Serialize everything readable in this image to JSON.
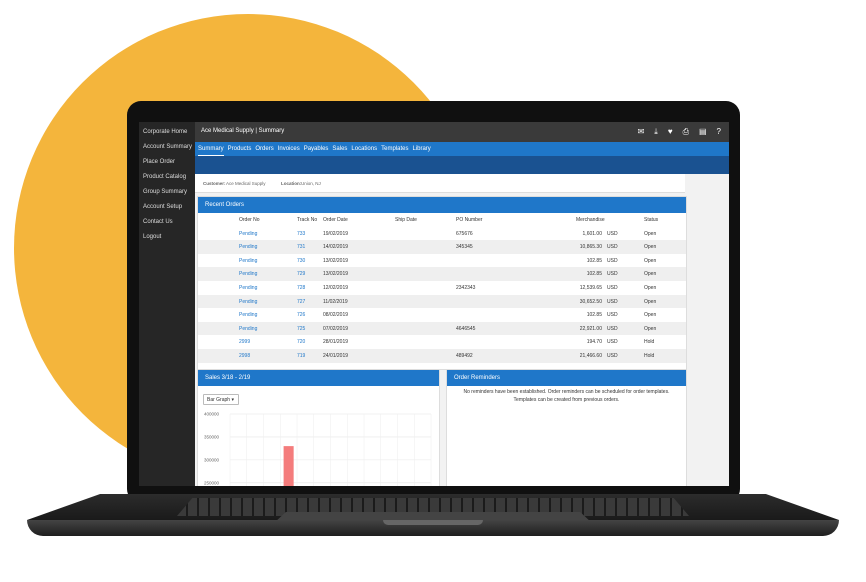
{
  "sidebar": {
    "items": [
      "Corporate Home",
      "Account Summary",
      "Place Order",
      "Product Catalog",
      "Group Summary",
      "Account Setup",
      "Contact Us",
      "Logout"
    ]
  },
  "header": {
    "title": "Ace Medical Supply  |  Summary",
    "icons": [
      "mail-icon",
      "download-icon",
      "heart-icon",
      "print-icon",
      "card-icon",
      "help-icon"
    ]
  },
  "nav": {
    "tabs": [
      "Summary",
      "Products",
      "Orders",
      "Invoices",
      "Payables",
      "Sales",
      "Locations",
      "Templates",
      "Library"
    ],
    "active": "Summary"
  },
  "customer": {
    "customer_label": "Customer:",
    "customer_value": "Ace Medical Supply",
    "location_label": "Location:",
    "location_value": "Union, NJ"
  },
  "recent_orders": {
    "title": "Recent Orders",
    "columns": [
      "Order No",
      "Track No",
      "Order Date",
      "Ship Date",
      "PO Number",
      "Merchandise",
      "Status"
    ],
    "rows": [
      {
        "order": "Pending",
        "track": "733",
        "date": "19/02/2019",
        "ship": "",
        "po": "675676",
        "amount": "1,601.00",
        "cur": "USD",
        "status": "Open"
      },
      {
        "order": "Pending",
        "track": "731",
        "date": "14/02/2019",
        "ship": "",
        "po": "345345",
        "amount": "10,865.30",
        "cur": "USD",
        "status": "Open"
      },
      {
        "order": "Pending",
        "track": "730",
        "date": "13/02/2019",
        "ship": "",
        "po": "",
        "amount": "102.85",
        "cur": "USD",
        "status": "Open"
      },
      {
        "order": "Pending",
        "track": "729",
        "date": "13/02/2019",
        "ship": "",
        "po": "",
        "amount": "102.85",
        "cur": "USD",
        "status": "Open"
      },
      {
        "order": "Pending",
        "track": "728",
        "date": "12/02/2019",
        "ship": "",
        "po": "2342343",
        "amount": "12,539.65",
        "cur": "USD",
        "status": "Open"
      },
      {
        "order": "Pending",
        "track": "727",
        "date": "11/02/2019",
        "ship": "",
        "po": "",
        "amount": "30,652.50",
        "cur": "USD",
        "status": "Open"
      },
      {
        "order": "Pending",
        "track": "726",
        "date": "08/02/2019",
        "ship": "",
        "po": "",
        "amount": "102.85",
        "cur": "USD",
        "status": "Open"
      },
      {
        "order": "Pending",
        "track": "725",
        "date": "07/02/2019",
        "ship": "",
        "po": "4646545",
        "amount": "22,921.00",
        "cur": "USD",
        "status": "Open"
      },
      {
        "order": "2999",
        "track": "720",
        "date": "28/01/2019",
        "ship": "",
        "po": "",
        "amount": "194.70",
        "cur": "USD",
        "status": "Hold"
      },
      {
        "order": "2998",
        "track": "719",
        "date": "24/01/2019",
        "ship": "",
        "po": "489492",
        "amount": "21,466.60",
        "cur": "USD",
        "status": "Hold"
      }
    ]
  },
  "sales": {
    "title": "Sales 3/18 - 2/19",
    "selected": "Bar Graph"
  },
  "chart_data": {
    "type": "bar",
    "y_ticks": [
      "400000",
      "350000",
      "300000",
      "250000"
    ],
    "ylim": [
      230000,
      400000
    ],
    "values": [
      null,
      null,
      null,
      330000,
      null,
      null,
      null,
      null,
      null,
      null,
      null,
      null
    ],
    "bar_color": "#F47C7C"
  },
  "reminders": {
    "title": "Order Reminders",
    "message": "No reminders have been established. Order reminders can be scheduled for order templates. Templates can be created from previous orders."
  },
  "colors": {
    "accent": "#1f77c9",
    "sidebar": "#262626",
    "brand_blob": "#F4B53C"
  }
}
